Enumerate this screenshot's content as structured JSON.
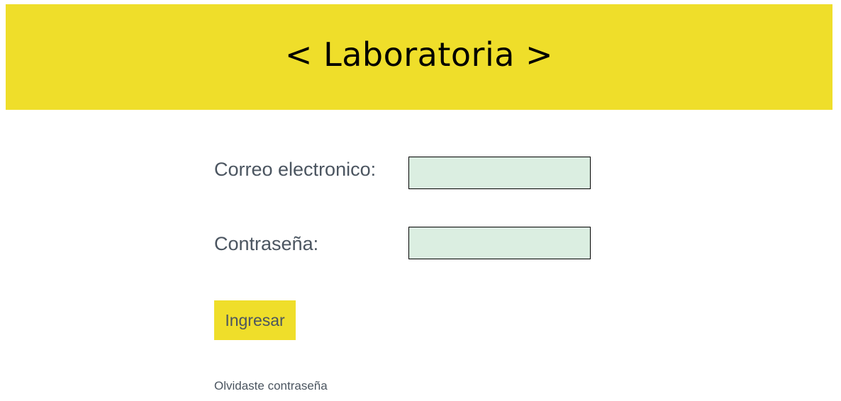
{
  "header": {
    "title": "< Laboratoria >"
  },
  "form": {
    "email_label": "Correo electronico:",
    "email_value": "",
    "password_label": "Contraseña:",
    "password_value": "",
    "submit_label": "Ingresar",
    "forgot_label": "Olvidaste contraseña"
  },
  "colors": {
    "brand_yellow": "#efde2a",
    "input_background": "#dbeee1",
    "text_gray": "#4b5560"
  }
}
